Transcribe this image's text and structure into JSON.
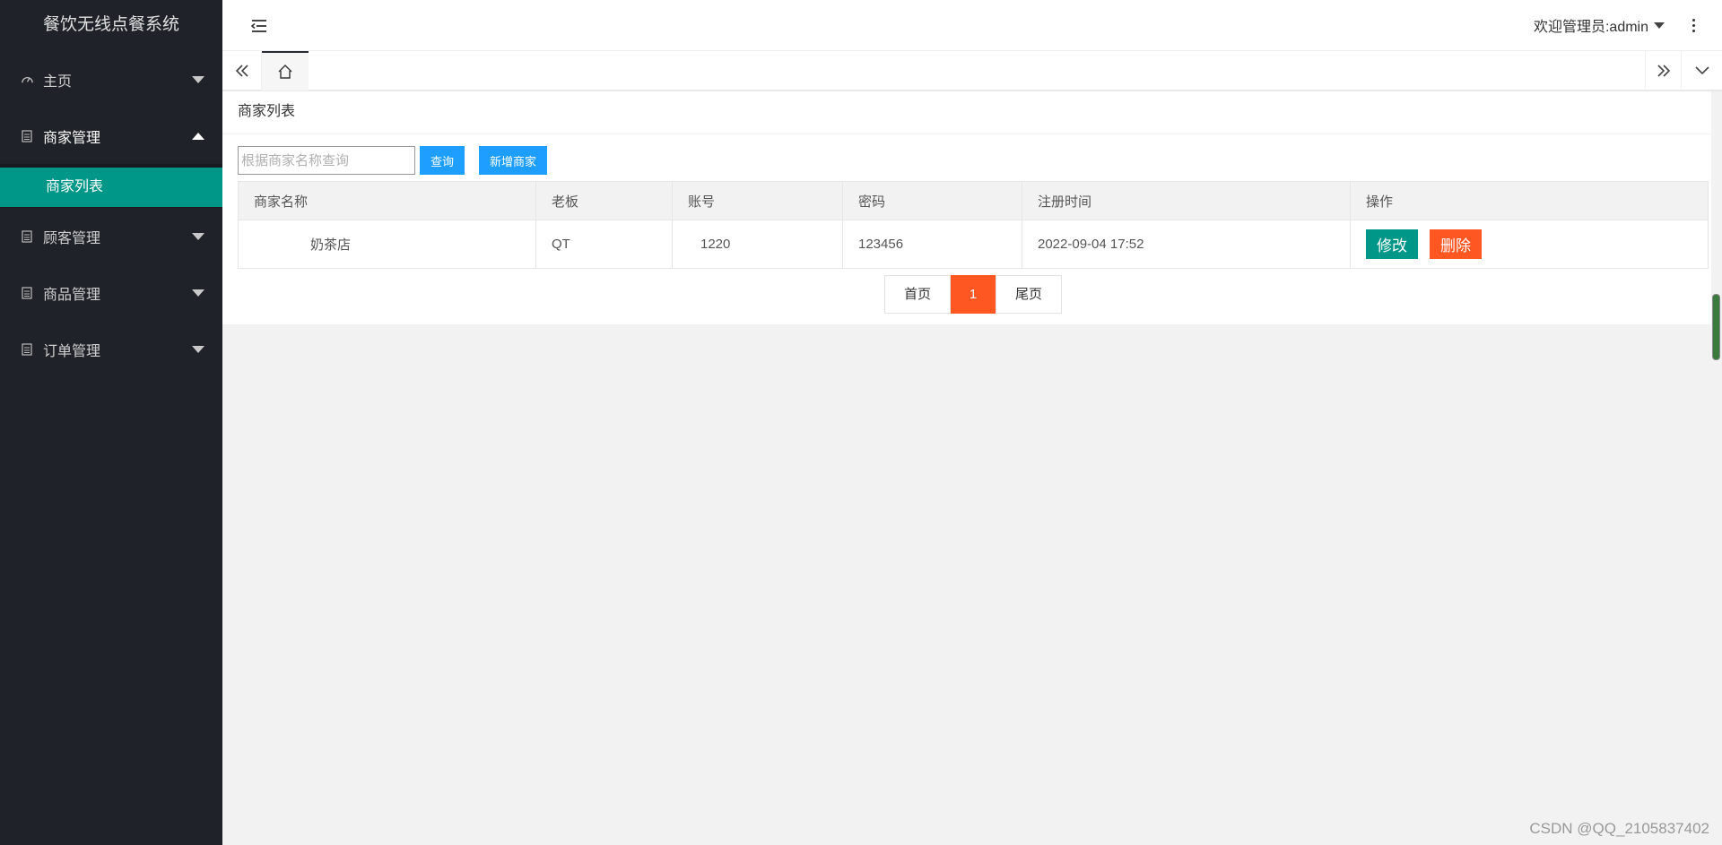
{
  "sidebar": {
    "logo": "餐饮无线点餐系统",
    "items": [
      {
        "label": "主页"
      },
      {
        "label": "商家管理",
        "open": true,
        "children": [
          {
            "label": "商家列表"
          }
        ]
      },
      {
        "label": "顾客管理"
      },
      {
        "label": "商品管理"
      },
      {
        "label": "订单管理"
      }
    ]
  },
  "header": {
    "user_label": "欢迎管理员:admin"
  },
  "card": {
    "title": "商家列表",
    "search_placeholder": "根据商家名称查询",
    "search_button": "查询",
    "add_button": "新增商家"
  },
  "table": {
    "headers": [
      "商家名称",
      "老板",
      "账号",
      "密码",
      "注册时间",
      "操作"
    ],
    "rows": [
      {
        "name": "奶茶店",
        "owner": "QT",
        "account": "1220",
        "password": "123456",
        "registered": "2022-09-04 17:52",
        "edit": "修改",
        "delete": "删除"
      }
    ]
  },
  "pager": {
    "first": "首页",
    "current": "1",
    "last": "尾页"
  },
  "watermark": "CSDN @QQ_2105837402",
  "colors": {
    "sidebar": "#20222a",
    "active": "#009688",
    "primary": "#1e9fff",
    "danger": "#ff5722"
  }
}
